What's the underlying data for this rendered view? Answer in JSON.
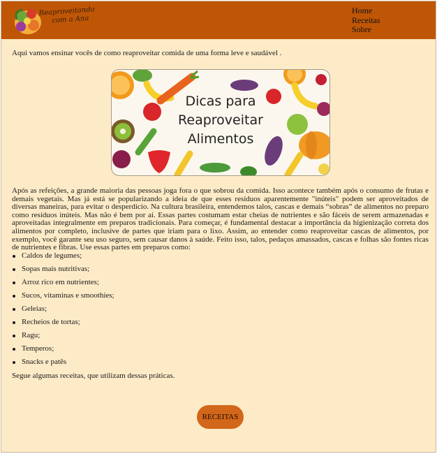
{
  "header": {
    "logo_line1": "Reaproveitando",
    "logo_line2": "com a Ana",
    "nav": [
      "Home",
      "Receitas",
      "Sobre"
    ]
  },
  "intro": "Aqui vamos ensinar vocês de como reaproveitar comida de uma forma leve e saudável .",
  "banner": {
    "title_line1": "Dicas para",
    "title_line2": "Reaproveitar",
    "title_line3": "Alimentos"
  },
  "article": {
    "paragraph": "Após as refeições, a grande maioria das pessoas joga fora o que sobrou da comida. Isso acontece também após o consumo de frutas e demais vegetais. Mas já está se popularizando a ideia de que esses resíduos aparentemente \"inúteis\" podem ser aproveitados de diversas maneiras, para evitar o desperdício. Na cultura brasileira, entendemos talos, cascas e demais “sobras” de alimentos no preparo como resíduos inúteis. Mas não é bem por aí. Essas partes costumam estar cheias de nutrientes e são fáceis de serem armazenadas e aproveitadas integralmente em preparos tradicionais. Para começar, é fundamental destacar a importância da higienização correta dos alimentos por completo, inclusive de partes que iriam para o lixo. Assim, ao entender como reaproveitar cascas de alimentos, por exemplo, você garante seu uso seguro, sem causar danos à saúde. Feito isso, talos, pedaços amassados, cascas e folhas são fontes ricas de nutrientes e fibras. Use essas partes em preparos como:",
    "items": [
      "Caldos de legumes;",
      "Sopas mais nutritivas;",
      "Arroz rico em nutrientes;",
      "Sucos, vitaminas e smoothies;",
      "Geleias;",
      "Recheios de tortas;",
      "Ragu;",
      "Temperos;",
      "Snacks e patês"
    ],
    "closing": "Segue algumas receitas, que utilizam dessas práticas."
  },
  "button_label": "RECEITAS",
  "colors": {
    "header": "#bf5606",
    "background": "#fdebc8",
    "button": "#d2661a"
  }
}
